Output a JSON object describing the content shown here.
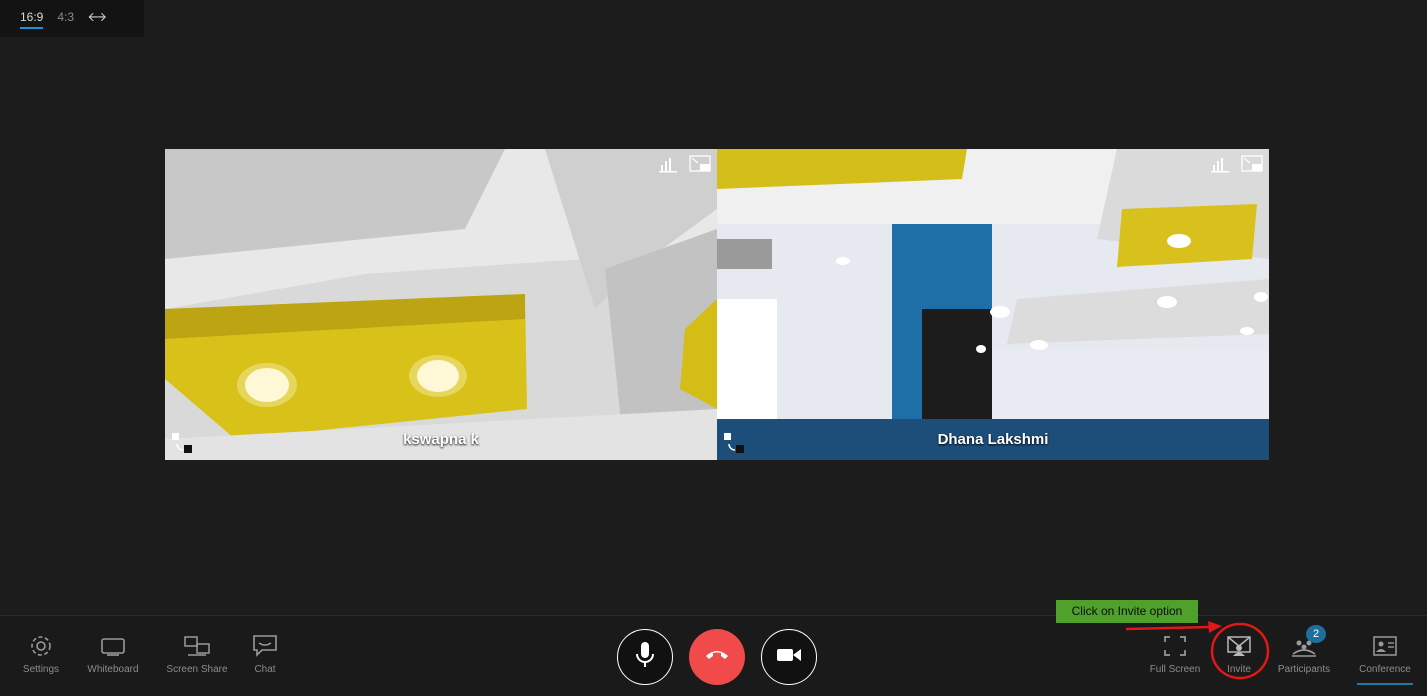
{
  "aspect": {
    "options": [
      "16:9",
      "4:3"
    ],
    "active": "16:9",
    "swap_icon": "swap-arrows-icon"
  },
  "participants_tiles": [
    {
      "name": "kswapna k"
    },
    {
      "name": "Dhana Lakshmi"
    }
  ],
  "toolbar": {
    "left": [
      {
        "label": "Settings",
        "icon": "gear-icon"
      },
      {
        "label": "Whiteboard",
        "icon": "whiteboard-icon"
      },
      {
        "label": "Screen Share",
        "icon": "screen-share-icon"
      },
      {
        "label": "Chat",
        "icon": "chat-icon"
      }
    ],
    "center": [
      {
        "name": "mic",
        "icon": "microphone-icon"
      },
      {
        "name": "end-call",
        "icon": "hang-up-icon",
        "color": "#f04a4a"
      },
      {
        "name": "camera",
        "icon": "video-camera-icon"
      }
    ],
    "right": [
      {
        "label": "Full Screen",
        "icon": "fullscreen-icon"
      },
      {
        "label": "Invite",
        "icon": "invite-icon"
      },
      {
        "label": "Participants",
        "icon": "participants-icon",
        "badge": "2"
      },
      {
        "label": "Conference",
        "icon": "conference-icon"
      }
    ]
  },
  "annotation": {
    "hint": "Click on Invite option",
    "color": "#4fa12b",
    "circle_color": "#e01818"
  }
}
